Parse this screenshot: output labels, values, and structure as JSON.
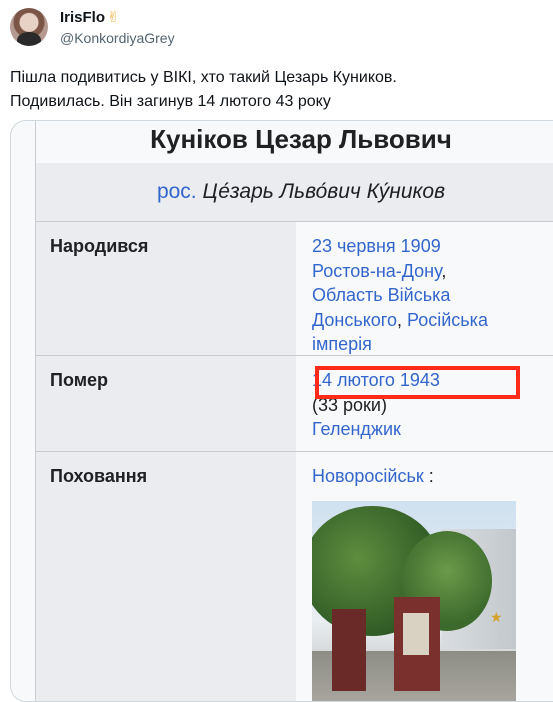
{
  "tweet": {
    "author_name": "IrisFlo",
    "author_emoji": "✌",
    "handle": "@KonkordiyaGrey",
    "text_lines": [
      "Пішла подивитись у ВІКІ, хто такий Цезарь Куников.",
      "Подивилась. Він загинув 14 лютого 43 року"
    ]
  },
  "infobox": {
    "title": "Куніков Цезар Львович",
    "subtitle_lang": "рос.",
    "subtitle_native": "Це́зарь Льво́вич Ку́ников",
    "born": {
      "label": "Народився",
      "date": "23 червня 1909",
      "city": "Ростов-на-Дону",
      "region_line1": "Область Війська",
      "region_line2": "Донського",
      "country_line1": "Російська",
      "country_line2": "імперія"
    },
    "died": {
      "label": "Помер",
      "date": "14 лютого 1943",
      "age": "(33 роки)",
      "place": "Геленджик"
    },
    "burial": {
      "label": "Поховання",
      "place": "Новоросійськ",
      "suffix": " :"
    }
  },
  "colors": {
    "link": "#3366cc",
    "highlight_box": "#ff2a1a",
    "label_bg": "#eaecf0"
  },
  "icons": [
    "avatar",
    "victory-hand-emoji",
    "star-icon"
  ]
}
